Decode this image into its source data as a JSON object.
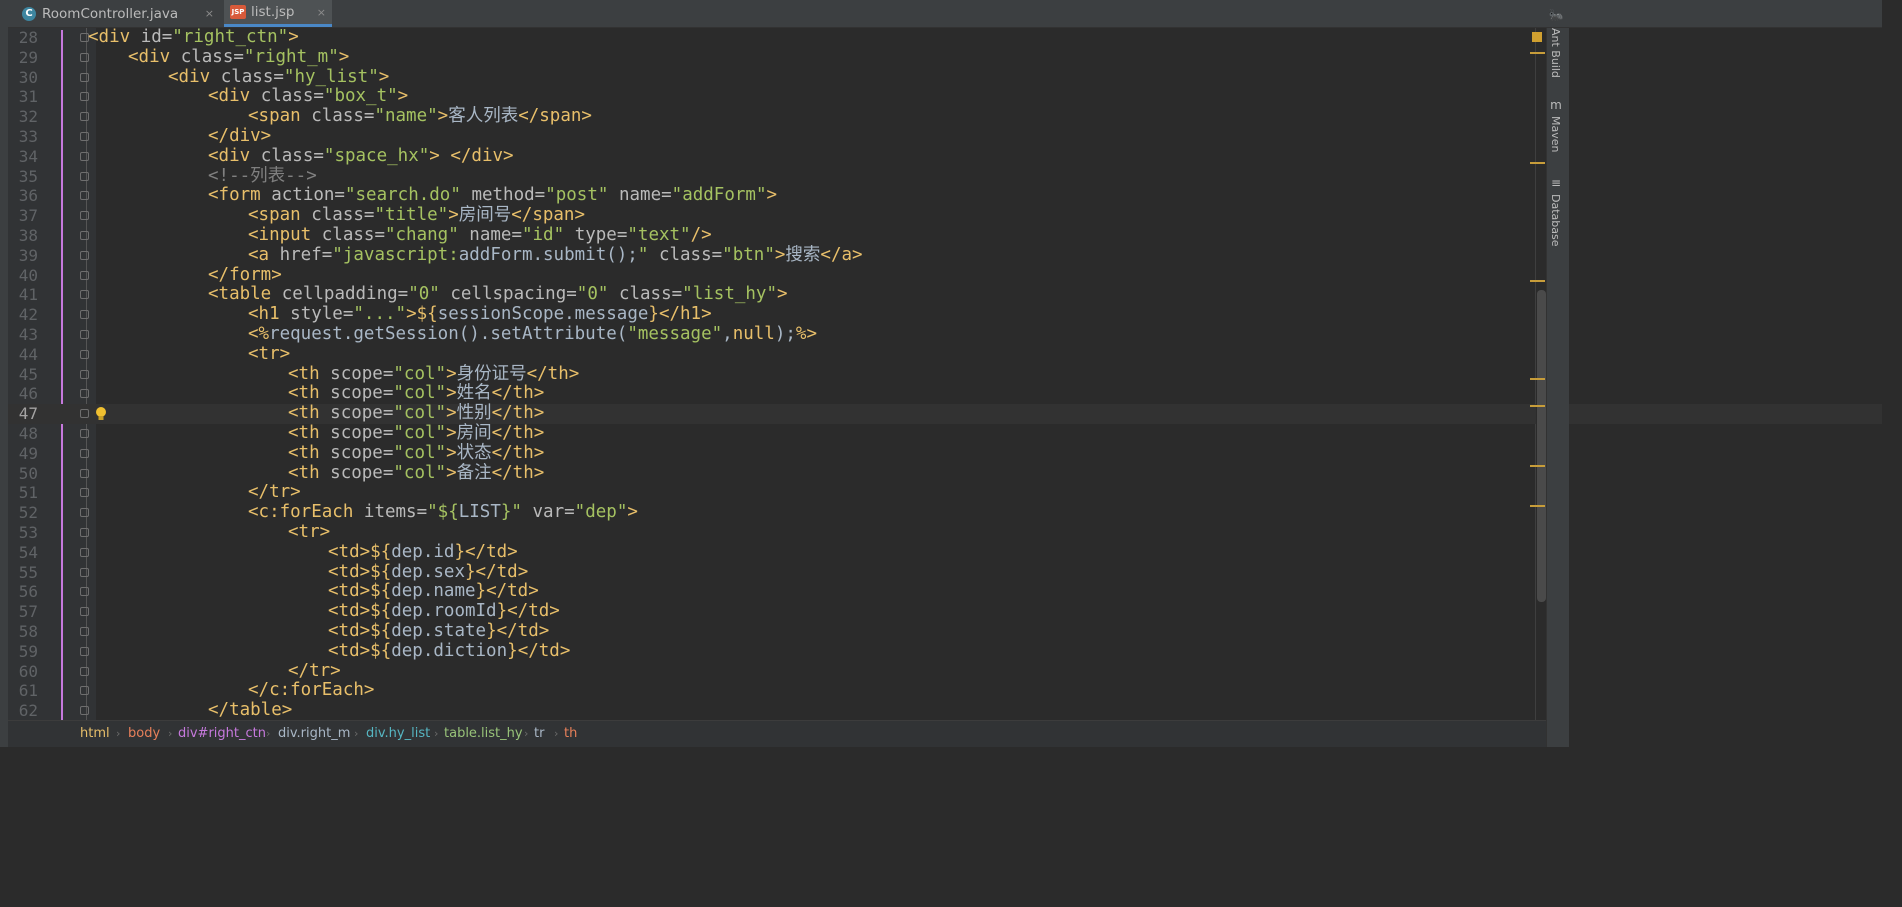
{
  "tabs": [
    {
      "label": "RoomController.java",
      "close": "×"
    },
    {
      "label": "list.jsp",
      "close": "×"
    }
  ],
  "right_tool_windows": [
    "Ant Build",
    "Maven",
    "Database"
  ],
  "breadcrumb": [
    "html",
    "body",
    "div#right_ctn",
    "div.right_m",
    "div.hy_list",
    "table.list_hy",
    "tr",
    "th"
  ],
  "code_lines": [
    {
      "num": "28",
      "indent": 0,
      "html": "<span class='tag'>&lt;div </span><span class='attr'>id=</span><span class='val'>\"right_ctn\"</span><span class='tag'>&gt;</span>"
    },
    {
      "num": "29",
      "indent": 1,
      "html": "<span class='tag'>&lt;div </span><span class='attr'>class=</span><span class='val'>\"right_m\"</span><span class='tag'>&gt;</span>"
    },
    {
      "num": "30",
      "indent": 2,
      "html": "<span class='tag'>&lt;div </span><span class='attr'>class=</span><span class='val'>\"hy_list\"</span><span class='tag'>&gt;</span>"
    },
    {
      "num": "31",
      "indent": 3,
      "html": "<span class='tag'>&lt;div </span><span class='attr'>class=</span><span class='val'>\"box_t\"</span><span class='tag'>&gt;</span>"
    },
    {
      "num": "32",
      "indent": 4,
      "html": "<span class='tag'>&lt;span </span><span class='attr'>class=</span><span class='val'>\"name\"</span><span class='tag'>&gt;</span><span class='cjk'>客人列表</span><span class='tag'>&lt;/span&gt;</span>"
    },
    {
      "num": "33",
      "indent": 3,
      "html": "<span class='tag'>&lt;/div&gt;</span>"
    },
    {
      "num": "34",
      "indent": 3,
      "html": "<span class='tag'>&lt;div </span><span class='attr'>class=</span><span class='val'>\"space_hx\"</span><span class='tag'>&gt;</span> <span class='tag'>&lt;/div&gt;</span>"
    },
    {
      "num": "35",
      "indent": 3,
      "html": "<span class='cmt'>&lt;!--列表--&gt;</span>"
    },
    {
      "num": "36",
      "indent": 3,
      "html": "<span class='tag'>&lt;form </span><span class='attr'>action=</span><span class='val'>\"search.do\"</span> <span class='attr'>method=</span><span class='val'>\"post\"</span> <span class='attr'>name=</span><span class='val'>\"addForm\"</span><span class='tag'>&gt;</span>"
    },
    {
      "num": "37",
      "indent": 4,
      "html": "<span class='tag'>&lt;span </span><span class='attr'>class=</span><span class='val'>\"title\"</span><span class='tag'>&gt;</span><span class='cjk'>房间号</span><span class='tag'>&lt;/span&gt;</span>"
    },
    {
      "num": "38",
      "indent": 4,
      "html": "<span class='tag'>&lt;input </span><span class='attr'>class=</span><span class='val'>\"chang\"</span> <span class='attr'>name=</span><span class='val'>\"id\"</span> <span class='attr'>type=</span><span class='val'>\"text\"</span><span class='tag'>/&gt;</span>"
    },
    {
      "num": "39",
      "indent": 4,
      "html": "<span class='tag'>&lt;a </span><span class='attr'>href=</span><span class='val'>\"javascript:</span><span class='el'>addForm.submit();</span><span class='val'>\"</span> <span class='attr'>class=</span><span class='val'>\"btn\"</span><span class='tag'>&gt;</span><span class='cjk'>搜索</span><span class='tag'>&lt;/a&gt;</span>"
    },
    {
      "num": "40",
      "indent": 3,
      "html": "<span class='tag'>&lt;/form&gt;</span>"
    },
    {
      "num": "41",
      "indent": 3,
      "html": "<span class='tag'>&lt;table </span><span class='attr'>cellpadding=</span><span class='val'>\"0\"</span> <span class='attr'>cellspacing=</span><span class='val'>\"0\"</span> <span class='attr'>class=</span><span class='val'>\"list_hy\"</span><span class='tag'>&gt;</span>"
    },
    {
      "num": "42",
      "indent": 4,
      "html": "<span class='tag'>&lt;h1 </span><span class='attr'>style=</span><span class='val'>\"...\"</span><span class='tag'>&gt;</span><span class='tag'>${</span><span class='el'>sessionScope.message</span><span class='tag'>}</span><span class='tag'>&lt;/h1&gt;</span>"
    },
    {
      "num": "43",
      "indent": 4,
      "html": "<span class='tag'>&lt;%</span><span class='el'>request.getSession().setAttribute(</span><span class='val'>\"message\"</span><span class='el'>,</span><span class='tag'>null</span><span class='el'>);</span><span class='tag'>%&gt;</span>"
    },
    {
      "num": "44",
      "indent": 4,
      "html": "<span class='tag'>&lt;tr&gt;</span>"
    },
    {
      "num": "45",
      "indent": 5,
      "html": "<span class='tag'>&lt;th </span><span class='attr'>scope=</span><span class='val'>\"col\"</span><span class='tag'>&gt;</span><span class='cjk'>身份证号</span><span class='tag'>&lt;/th&gt;</span>"
    },
    {
      "num": "46",
      "indent": 5,
      "html": "<span class='tag'>&lt;th </span><span class='attr'>scope=</span><span class='val'>\"col\"</span><span class='tag'>&gt;</span><span class='cjk'>姓名</span><span class='tag'>&lt;/th&gt;</span>"
    },
    {
      "num": "47",
      "indent": 5,
      "current": true,
      "html": "<span class='tag'>&lt;th </span><span class='attr'>scope=</span><span class='val'>\"col\"</span><span class='tag'>&gt;</span><span class='cjk'>性别</span><span class='tag'>&lt;/th&gt;</span>"
    },
    {
      "num": "48",
      "indent": 5,
      "html": "<span class='tag'>&lt;th </span><span class='attr'>scope=</span><span class='val'>\"col\"</span><span class='tag'>&gt;</span><span class='cjk'>房间</span><span class='tag'>&lt;/th&gt;</span>"
    },
    {
      "num": "49",
      "indent": 5,
      "html": "<span class='tag'>&lt;th </span><span class='attr'>scope=</span><span class='val'>\"col\"</span><span class='tag'>&gt;</span><span class='cjk'>状态</span><span class='tag'>&lt;/th&gt;</span>"
    },
    {
      "num": "50",
      "indent": 5,
      "html": "<span class='tag'>&lt;th </span><span class='attr'>scope=</span><span class='val'>\"col\"</span><span class='tag'>&gt;</span><span class='cjk'>备注</span><span class='tag'>&lt;/th&gt;</span>"
    },
    {
      "num": "51",
      "indent": 4,
      "html": "<span class='tag'>&lt;/tr&gt;</span>"
    },
    {
      "num": "52",
      "indent": 4,
      "html": "<span class='tag'>&lt;c:forEach </span><span class='attr'>items=</span><span class='val'>\"${</span><span class='el'>LIST</span><span class='val'>}\"</span> <span class='attr'>var=</span><span class='val'>\"dep\"</span><span class='tag'>&gt;</span>"
    },
    {
      "num": "53",
      "indent": 5,
      "html": "<span class='tag'>&lt;tr&gt;</span>"
    },
    {
      "num": "54",
      "indent": 6,
      "html": "<span class='tag'>&lt;td&gt;</span><span class='tag'>${</span><span class='el'>dep.id</span><span class='tag'>}</span><span class='tag'>&lt;/td&gt;</span>"
    },
    {
      "num": "55",
      "indent": 6,
      "html": "<span class='tag'>&lt;td&gt;</span><span class='tag'>${</span><span class='el'>dep.sex</span><span class='tag'>}</span><span class='tag'>&lt;/td&gt;</span>"
    },
    {
      "num": "56",
      "indent": 6,
      "html": "<span class='tag'>&lt;td&gt;</span><span class='tag'>${</span><span class='el'>dep.name</span><span class='tag'>}</span><span class='tag'>&lt;/td&gt;</span>"
    },
    {
      "num": "57",
      "indent": 6,
      "html": "<span class='tag'>&lt;td&gt;</span><span class='tag'>${</span><span class='el'>dep.roomId</span><span class='tag'>}</span><span class='tag'>&lt;/td&gt;</span>"
    },
    {
      "num": "58",
      "indent": 6,
      "html": "<span class='tag'>&lt;td&gt;</span><span class='tag'>${</span><span class='el'>dep.state</span><span class='tag'>}</span><span class='tag'>&lt;/td&gt;</span>"
    },
    {
      "num": "59",
      "indent": 6,
      "html": "<span class='tag'>&lt;td&gt;</span><span class='tag'>${</span><span class='el'>dep.diction</span><span class='tag'>}</span><span class='tag'>&lt;/td&gt;</span>"
    },
    {
      "num": "60",
      "indent": 5,
      "html": "<span class='tag'>&lt;/tr&gt;</span>"
    },
    {
      "num": "61",
      "indent": 4,
      "html": "<span class='tag'>&lt;/c:forEach&gt;</span>"
    },
    {
      "num": "62",
      "indent": 3,
      "html": "<span class='tag'>&lt;/table&gt;</span>"
    }
  ],
  "colors": {
    "background": "#2b2b2b",
    "tag": "#e8bf6a",
    "attribute": "#bababa",
    "string": "#a5c261",
    "text": "#a9b7c6",
    "line_number": "#606366"
  }
}
